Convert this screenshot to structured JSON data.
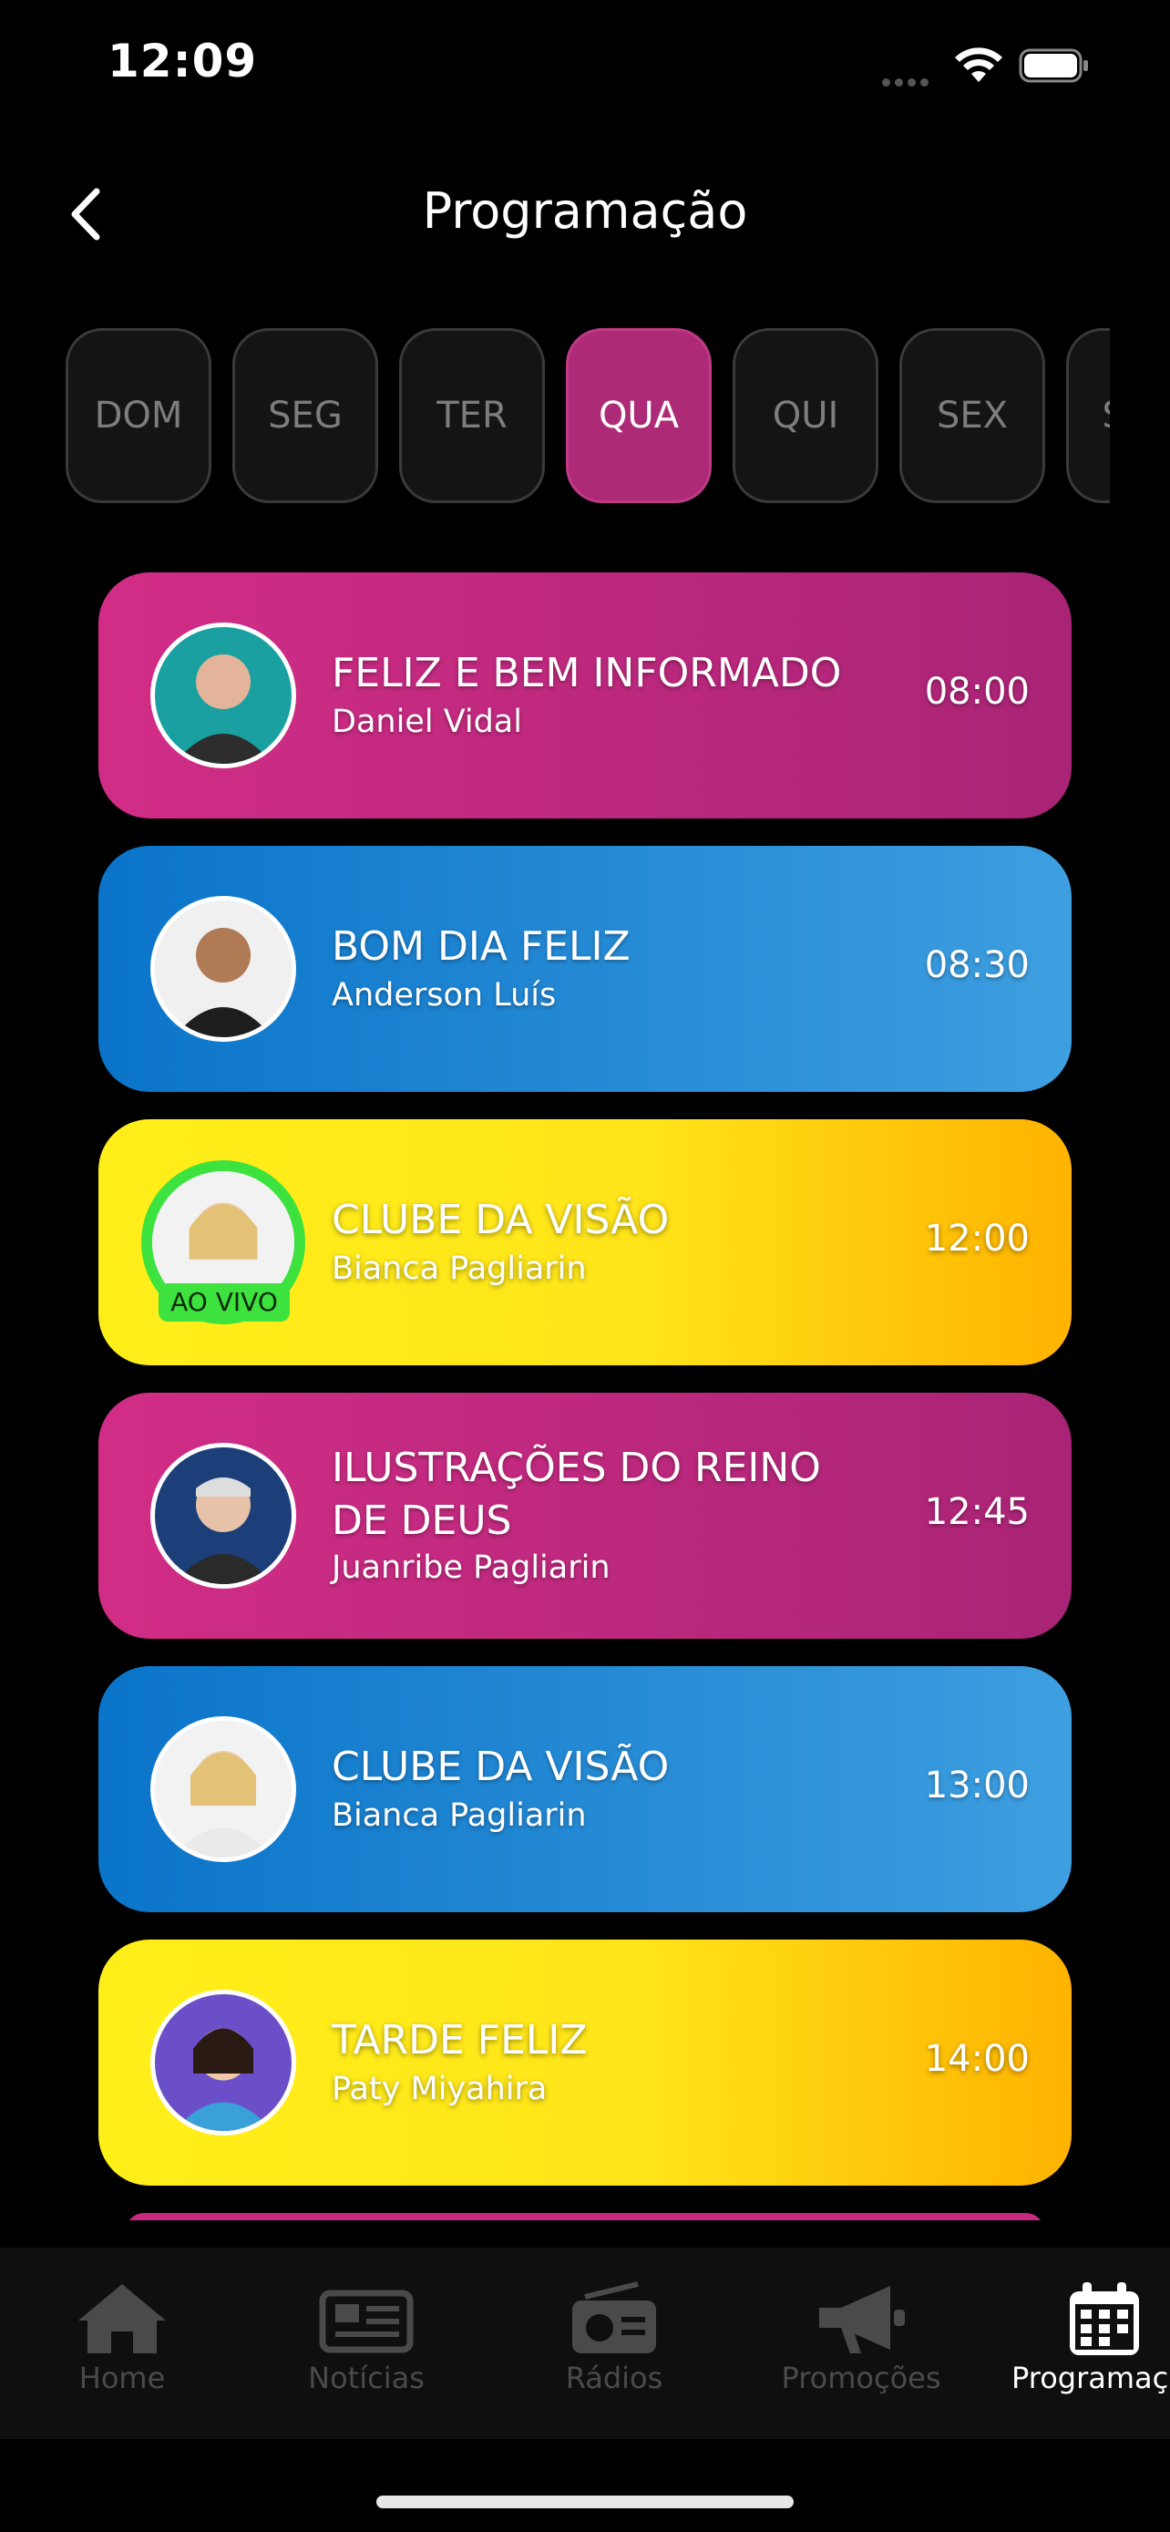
{
  "status_bar": {
    "time": "12:09"
  },
  "header": {
    "title": "Programação"
  },
  "days": [
    {
      "label": "DOM",
      "active": false
    },
    {
      "label": "SEG",
      "active": false
    },
    {
      "label": "TER",
      "active": false
    },
    {
      "label": "QUA",
      "active": true
    },
    {
      "label": "QUI",
      "active": false
    },
    {
      "label": "SEX",
      "active": false
    },
    {
      "label": "SAB",
      "active": false
    }
  ],
  "programs": [
    {
      "title": "FELIZ E BEM INFORMADO",
      "host": "Daniel Vidal",
      "time": "08:00",
      "color": "#c42a80"
    },
    {
      "title": "BOM DIA FELIZ",
      "host": "Anderson Luís",
      "time": "08:30",
      "color": "#1c86d3"
    },
    {
      "title": "CLUBE DA VISÃO",
      "host": "Bianca Pagliarin",
      "time": "12:00",
      "color": "#ffe41a",
      "live_label": "AO VIVO"
    },
    {
      "title": "ILUSTRAÇÕES DO REINO DE DEUS",
      "host": "Juanribe Pagliarin",
      "time": "12:45",
      "color": "#c42a80"
    },
    {
      "title": "CLUBE DA VISÃO",
      "host": "Bianca Pagliarin",
      "time": "13:00",
      "color": "#1c86d3"
    },
    {
      "title": "TARDE FELIZ",
      "host": "Paty Miyahira",
      "time": "14:00",
      "color": "#ffe41a"
    }
  ],
  "tabs": [
    {
      "label": "Home",
      "icon": "home-icon",
      "active": false
    },
    {
      "label": "Notícias",
      "icon": "newspaper-icon",
      "active": false
    },
    {
      "label": "Rádios",
      "icon": "radio-icon",
      "active": false
    },
    {
      "label": "Promoções",
      "icon": "megaphone-icon",
      "active": false
    },
    {
      "label": "Programação",
      "icon": "calendar-icon",
      "active": true
    }
  ],
  "colors": {
    "accent": "#ad2b76",
    "live": "#3ee23f",
    "background": "#000000"
  }
}
